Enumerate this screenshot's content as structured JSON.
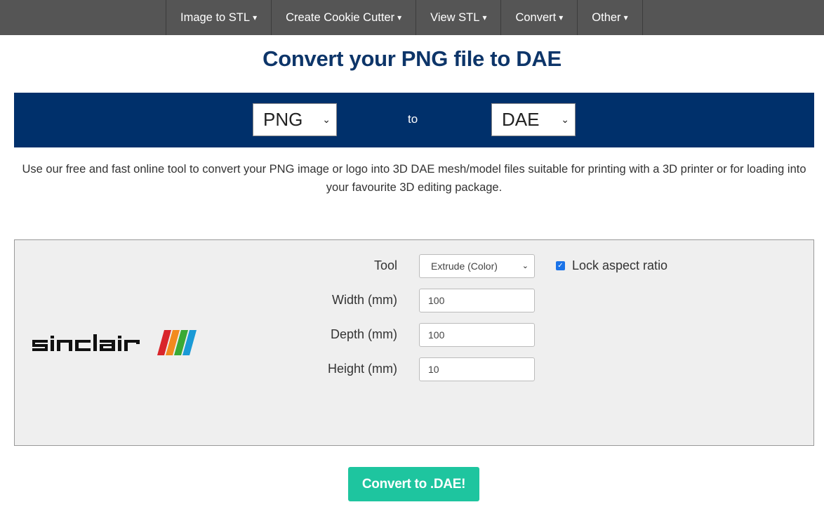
{
  "nav": {
    "items": [
      {
        "label": "Image to STL",
        "caret": "▾"
      },
      {
        "label": "Create Cookie Cutter",
        "caret": "▾"
      },
      {
        "label": "View STL",
        "caret": "▾"
      },
      {
        "label": "Convert",
        "caret": "▾"
      },
      {
        "label": "Other",
        "caret": "▾"
      }
    ]
  },
  "page_title": "Convert your PNG file to DAE",
  "converter": {
    "from_format": "PNG",
    "to_label": "to",
    "to_format": "DAE",
    "bar_color": "#00306b"
  },
  "description": "Use our free and fast online tool to convert your PNG image or logo into 3D DAE mesh/model files suitable for printing with a 3D printer or for loading into your favourite 3D editing package.",
  "settings": {
    "preview_logo": "sinclair",
    "tool_label": "Tool",
    "tool_value": "Extrude (Color)",
    "width_label": "Width (mm)",
    "width_value": "100",
    "depth_label": "Depth (mm)",
    "depth_value": "100",
    "height_label": "Height (mm)",
    "height_value": "10",
    "lock_label": "Lock aspect ratio",
    "lock_checked": true
  },
  "convert_button": {
    "label": "Convert to .DAE!",
    "color": "#1ec59f"
  }
}
